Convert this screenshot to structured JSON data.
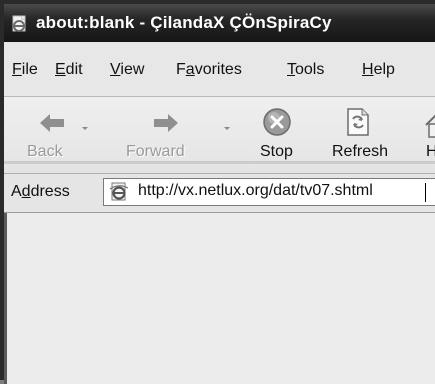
{
  "window": {
    "title": "about:blank - ÇilandaX ÇÖnSpiraCy",
    "title_icon": "ie-page-icon"
  },
  "menu": [
    {
      "prefix": "",
      "accel": "F",
      "rest": "ile"
    },
    {
      "prefix": "",
      "accel": "E",
      "rest": "dit"
    },
    {
      "prefix": "",
      "accel": "V",
      "rest": "iew"
    },
    {
      "prefix": "F",
      "accel": "a",
      "rest": "vorites"
    },
    {
      "prefix": "",
      "accel": "T",
      "rest": "ools"
    },
    {
      "prefix": "",
      "accel": "H",
      "rest": "elp"
    }
  ],
  "toolbar": {
    "back": {
      "label": "Back",
      "icon": "back-arrow-icon",
      "enabled": false
    },
    "forward": {
      "label": "Forward",
      "icon": "forward-arrow-icon",
      "enabled": false
    },
    "stop": {
      "label": "Stop",
      "icon": "stop-icon",
      "enabled": true
    },
    "refresh": {
      "label": "Refresh",
      "icon": "refresh-icon",
      "enabled": true
    },
    "home": {
      "label": "H",
      "icon": "home-icon",
      "enabled": true
    }
  },
  "address": {
    "label_prefix": "A",
    "label_accel": "d",
    "label_rest": "dress",
    "url": "http://vx.netlux.org/dat/tv07.shtml",
    "icon": "ie-page-icon"
  },
  "colors": {
    "titlebar": "#1e1e1e",
    "chrome": "#e7e7e7",
    "content_bg": "#ececec"
  }
}
